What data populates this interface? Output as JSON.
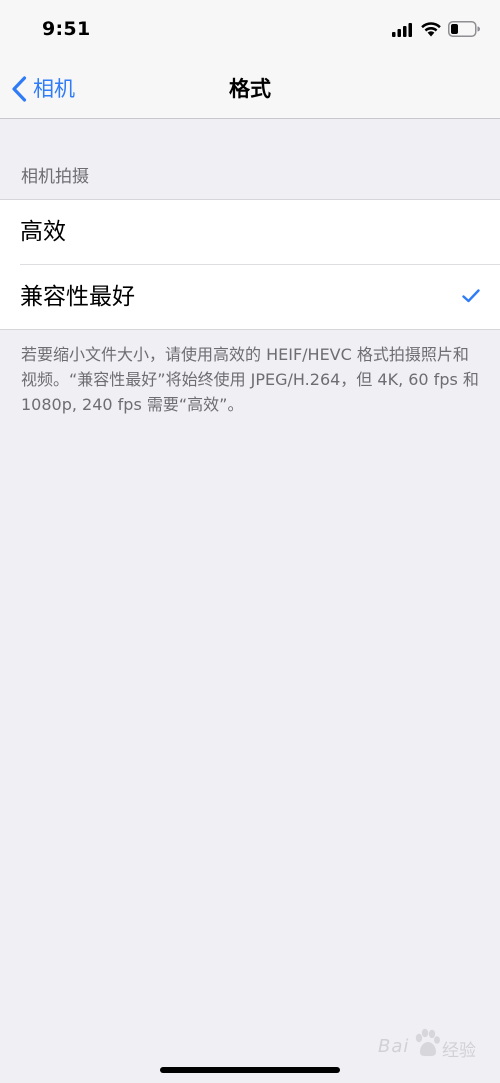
{
  "status_bar": {
    "time": "9:51",
    "icons": [
      "signal-icon",
      "wifi-icon",
      "battery-icon"
    ]
  },
  "nav": {
    "back_label": "相机",
    "title": "格式"
  },
  "section": {
    "header": "相机拍摄",
    "options": [
      {
        "label": "高效",
        "selected": false
      },
      {
        "label": "兼容性最好",
        "selected": true
      }
    ],
    "footer": "若要缩小文件大小，请使用高效的 HEIF/HEVC 格式拍摄照片和视频。“兼容性最好”将始终使用 JPEG/H.264，但 4K, 60 fps 和 1080p, 240 fps 需要“高效”。"
  },
  "watermark": {
    "text_left": "Bai",
    "text_right": "经验"
  },
  "colors": {
    "accent": "#2f7cf6",
    "background": "#efeff4",
    "secondary_text": "#6d6d72"
  }
}
